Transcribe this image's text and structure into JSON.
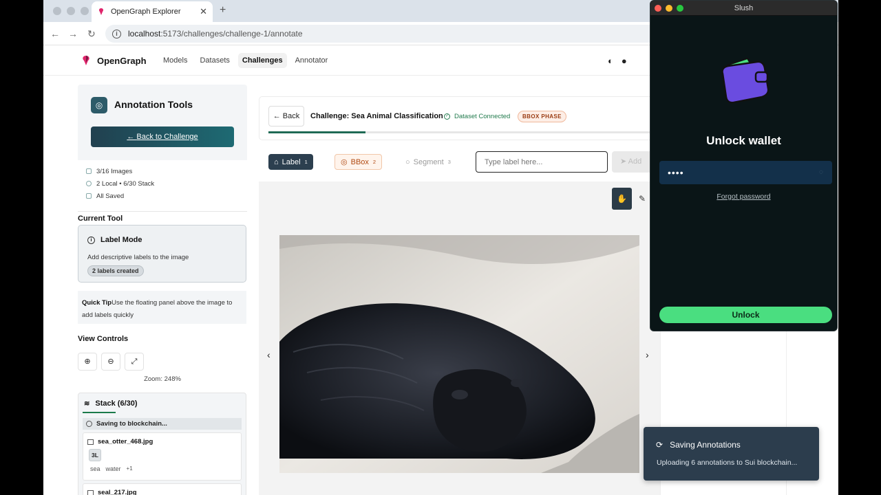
{
  "browser": {
    "tab_title": "OpenGraph Explorer",
    "url_host": "localhost",
    "url_path": ":5173/challenges/challenge-1/annotate"
  },
  "app": {
    "brand": "OpenGraph",
    "nav": [
      "Models",
      "Datasets",
      "Challenges",
      "Annotator"
    ],
    "active_nav": "Challenges"
  },
  "sidebar": {
    "title": "Annotation Tools",
    "back_label": "Back to Challenge",
    "stats": [
      "3/16 Images",
      "2 Local • 6/30 Stack",
      "All Saved"
    ],
    "current_tool_heading": "Current Tool",
    "mode_title": "Label Mode",
    "mode_desc": "Add descriptive labels to the image",
    "mode_badge": "2 labels created",
    "tip_label": "Quick Tip",
    "tip_text": "Use the floating panel above the image to add labels quickly",
    "view_controls_heading": "View Controls",
    "zoom_label": "Zoom: 248%",
    "stack_title": "Stack (6/30)",
    "saving_row": "Saving to blockchain...",
    "files": [
      {
        "name": "sea_otter_468.jpg",
        "count": "3L",
        "tags": [
          "sea",
          "water"
        ],
        "more": "+1"
      },
      {
        "name": "seal_217.jpg"
      }
    ]
  },
  "challenge": {
    "back_label": "Back",
    "title": "Challenge: Sea Animal Classification",
    "dataset_status": "Dataset Connected",
    "phase": "BBOX PHASE",
    "progress": 0.25
  },
  "toolbar": {
    "modes": [
      {
        "label": "Label",
        "num": "1"
      },
      {
        "label": "BBox",
        "num": "2"
      },
      {
        "label": "Segment",
        "num": "3"
      }
    ],
    "input_placeholder": "Type label here...",
    "add_label": "Add"
  },
  "wallet": {
    "app_title": "Slush",
    "heading": "Unlock wallet",
    "password_masked": "••••",
    "forgot_label": "Forgot password",
    "unlock_label": "Unlock"
  },
  "toast": {
    "title": "Saving Annotations",
    "message": "Uploading 6 annotations to Sui blockchain..."
  },
  "colors": {
    "accent_dark": "#2c3f4f",
    "success_green": "#207a4c",
    "wallet_button": "#4ade80",
    "bbox_orange": "#b04a12"
  }
}
